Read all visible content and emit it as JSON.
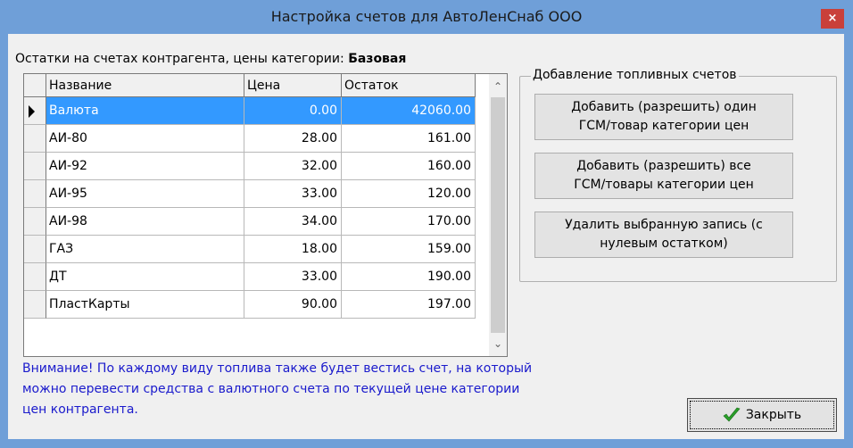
{
  "window": {
    "title": "Настройка счетов для АвтоЛенСнаб ООО",
    "close_glyph": "×"
  },
  "info": {
    "prefix": "Остатки на счетах контрагента, цены категории:",
    "category": "Базовая"
  },
  "table": {
    "columns": [
      "Название",
      "Цена",
      "Остаток"
    ],
    "rows": [
      {
        "name": "Валюта",
        "price": "0.00",
        "balance": "42060.00",
        "selected": true
      },
      {
        "name": "АИ-80",
        "price": "28.00",
        "balance": "161.00"
      },
      {
        "name": "АИ-92",
        "price": "32.00",
        "balance": "160.00"
      },
      {
        "name": "АИ-95",
        "price": "33.00",
        "balance": "120.00"
      },
      {
        "name": "АИ-98",
        "price": "34.00",
        "balance": "170.00"
      },
      {
        "name": "ГАЗ",
        "price": "18.00",
        "balance": "159.00"
      },
      {
        "name": "ДТ",
        "price": "33.00",
        "balance": "190.00"
      },
      {
        "name": "ПластКарты",
        "price": "90.00",
        "balance": "197.00"
      }
    ]
  },
  "fuel_group": {
    "title": "Добавление топливных счетов",
    "buttons": [
      [
        "Добавить (разрешить) один",
        "ГСМ/товар категории цен"
      ],
      [
        "Добавить (разрешить) все",
        "ГСМ/товары категории цен"
      ],
      [
        "Удалить выбранную запись (с",
        "нулевым остатком)"
      ]
    ]
  },
  "notice": {
    "lines": [
      "Внимание! По каждому виду топлива также будет вестись счет, на который",
      "можно перевести средства с валютного счета по текущей цене категории",
      "цен контрагента."
    ]
  },
  "close_button": {
    "label": "Закрыть",
    "icon": "checkmark-icon"
  },
  "colors": {
    "title_bar": "#6f9fd8",
    "selection": "#3399ff",
    "notice_text": "#1a1acc",
    "close_red": "#c9403a",
    "check_green": "#2aa02a"
  }
}
